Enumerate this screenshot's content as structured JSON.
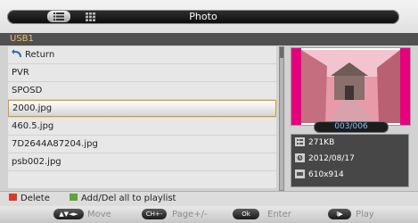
{
  "header": {
    "title": "Photo"
  },
  "source": {
    "label": "USB1"
  },
  "filelist": {
    "items": [
      {
        "label": "Return"
      },
      {
        "label": "PVR"
      },
      {
        "label": "SPOSD"
      },
      {
        "label": "2000.jpg"
      },
      {
        "label": "460.5.jpg"
      },
      {
        "label": "7D2644A87204.jpg"
      },
      {
        "label": "psb002.jpg"
      }
    ],
    "selected_index": 3
  },
  "preview": {
    "counter": "003/006",
    "size": "271KB",
    "date": "2012/08/17",
    "resolution": "610x914"
  },
  "hints": {
    "delete_label": "Delete",
    "add_label": "Add/Del all to playlist",
    "delete_color": "#d83a2a",
    "add_color": "#5fa43a"
  },
  "navbar": {
    "move_key": "▲▼◄►",
    "move_label": "Move",
    "page_key": "CH+-",
    "page_label": "Page+/-",
    "enter_key": "Ok",
    "enter_label": "Enter",
    "play_key": "I▶",
    "play_label": "Play"
  },
  "colors": {
    "accent": "#d89b1d",
    "counter_text": "#7fc7ff"
  },
  "icons": [
    "list-view-icon",
    "grid-view-icon",
    "return-icon",
    "file-size-icon",
    "date-icon",
    "resolution-icon"
  ]
}
